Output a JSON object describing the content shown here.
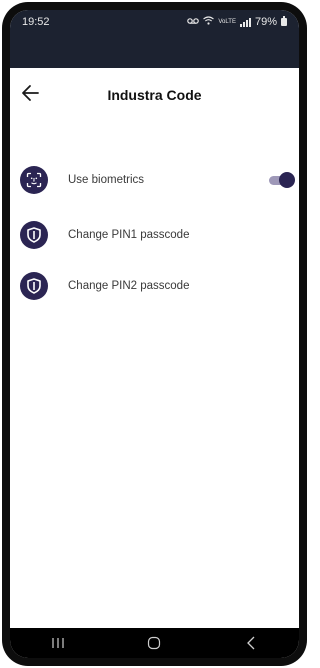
{
  "status_bar": {
    "time": "19:52",
    "network_label": "VoLTE",
    "battery_percent": "79%"
  },
  "header": {
    "title": "Industra Code"
  },
  "settings": {
    "items": [
      {
        "label": "Use biometrics",
        "icon": "face-id-icon",
        "toggle_on": true
      },
      {
        "label": "Change PIN1 passcode",
        "icon": "shield-icon"
      },
      {
        "label": "Change PIN2 passcode",
        "icon": "shield-icon"
      }
    ]
  },
  "colors": {
    "accent": "#2b2553",
    "status_bar_bg": "#1c2230",
    "toggle_track": "#9e98b8"
  }
}
